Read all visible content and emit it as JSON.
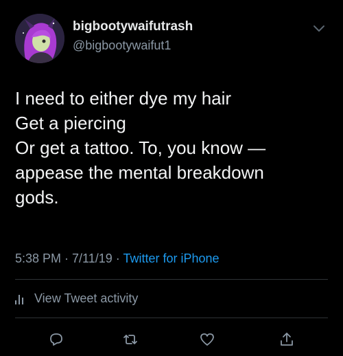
{
  "tweet": {
    "display_name": "bigbootywaifutrash",
    "handle": "@bigbootywaifut1",
    "text_lines": [
      "I need to either dye my hair",
      "Get a piercing",
      "Or get a tattoo. To, you know —",
      "appease the mental breakdown",
      "gods."
    ],
    "time": "5:38 PM",
    "separator": " · ",
    "date": "7/11/19",
    "source": "Twitter for iPhone",
    "activity_label": "View Tweet activity"
  },
  "colors": {
    "background": "#000000",
    "text": "#e7e9ea",
    "secondary": "#8b98a5",
    "accent": "#1d9bf0",
    "divider": "#2f3336"
  },
  "icons": {
    "avatar": "avatar-anime-character",
    "menu": "chevron-down-icon",
    "activity": "bar-chart-icon",
    "reply": "reply-icon",
    "retweet": "retweet-icon",
    "like": "heart-icon",
    "share": "share-icon"
  }
}
